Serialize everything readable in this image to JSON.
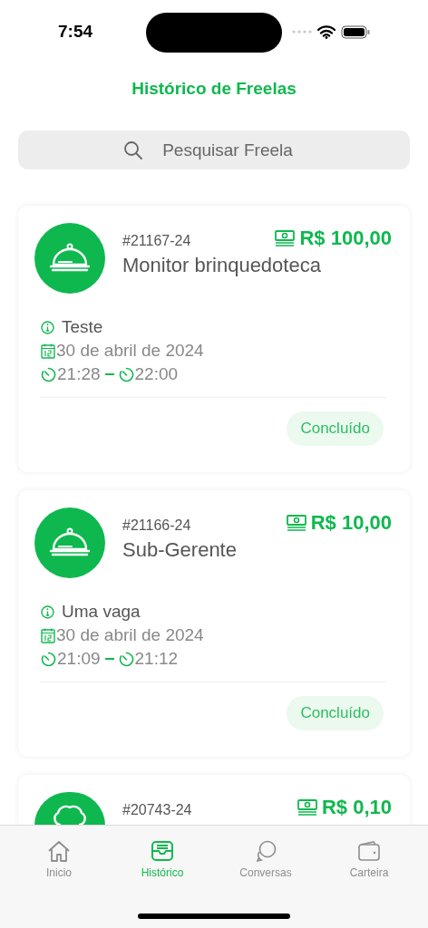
{
  "status_bar": {
    "time": "7:54"
  },
  "header": {
    "title": "Histórico de Freelas"
  },
  "search": {
    "placeholder": "Pesquisar Freela"
  },
  "jobs": [
    {
      "code": "#21167-24",
      "title": "Monitor brinquedoteca",
      "amount": "R$ 100,00",
      "description": "Teste",
      "date": "30 de abril de 2024",
      "start": "21:28",
      "end": "22:00",
      "status": "Concluído"
    },
    {
      "code": "#21166-24",
      "title": "Sub-Gerente",
      "amount": "R$ 10,00",
      "description": "Uma vaga",
      "date": "30 de abril de 2024",
      "start": "21:09",
      "end": "21:12",
      "status": "Concluído"
    },
    {
      "code": "#20743-24",
      "amount": "R$ 0,10"
    }
  ],
  "tabs": [
    {
      "label": "Inicio",
      "selected": false
    },
    {
      "label": "Histórico",
      "selected": true
    },
    {
      "label": "Conversas",
      "selected": false
    },
    {
      "label": "Carteira",
      "selected": false
    }
  ]
}
